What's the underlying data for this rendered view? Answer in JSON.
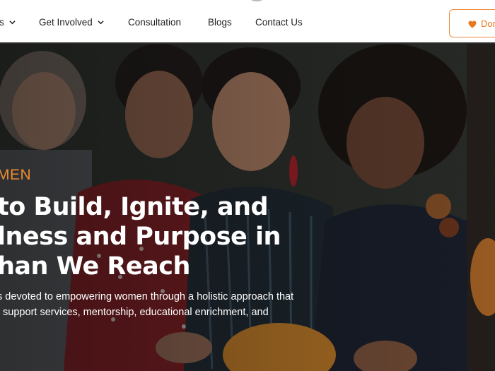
{
  "nav": {
    "items": [
      {
        "label": "s",
        "has_dropdown": true
      },
      {
        "label": "Get Involved",
        "has_dropdown": true
      },
      {
        "label": "Consultation",
        "has_dropdown": false
      },
      {
        "label": "Blogs",
        "has_dropdown": false
      },
      {
        "label": "Contact Us",
        "has_dropdown": false
      }
    ],
    "donate_label": "Don",
    "donate_icon": "heart-icon"
  },
  "hero": {
    "eyebrow": "MEN",
    "headline_lines": [
      "to Build, Ignite, and",
      "lness and Purpose in",
      "han We Reach"
    ],
    "description_lines": [
      "s devoted to empowering women through a holistic approach that",
      ", support services, mentorship, educational enrichment, and"
    ]
  },
  "colors": {
    "accent": "#ee8b2e",
    "nav_text": "#1f1f1f",
    "hero_text": "#ffffff"
  }
}
